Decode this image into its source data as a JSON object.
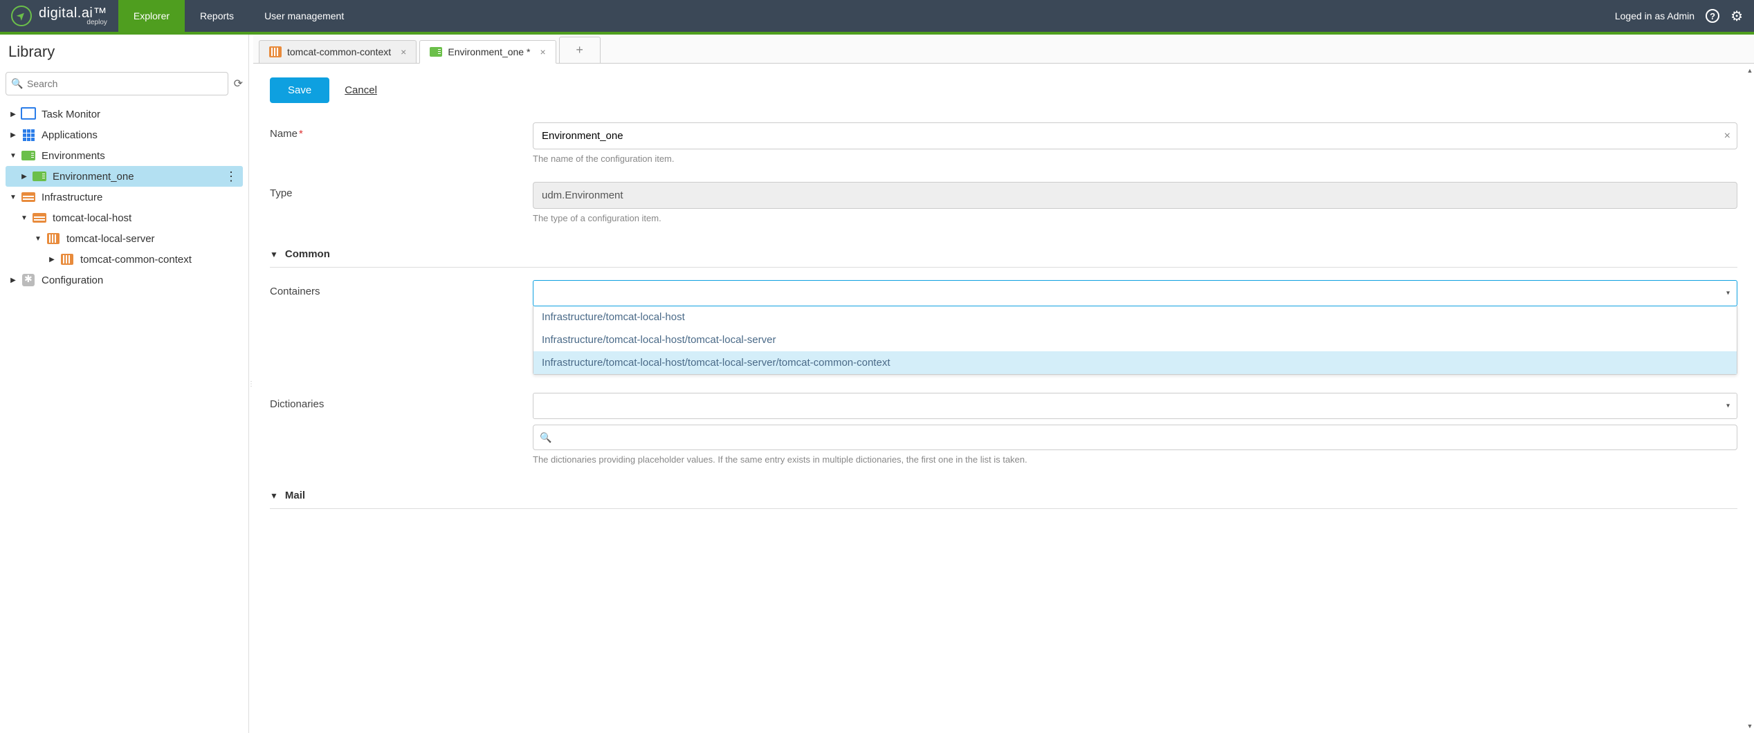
{
  "brand": {
    "name": "digital.ai",
    "sub": "deploy"
  },
  "nav": {
    "explorer": "Explorer",
    "reports": "Reports",
    "user_mgmt": "User management"
  },
  "topbar": {
    "logged_in": "Loged in as Admin"
  },
  "sidebar": {
    "title": "Library",
    "search_placeholder": "Search",
    "tree": {
      "task_monitor": "Task Monitor",
      "applications": "Applications",
      "environments": "Environments",
      "env_one": "Environment_one",
      "infrastructure": "Infrastructure",
      "tomcat_host": "tomcat-local-host",
      "tomcat_server": "tomcat-local-server",
      "tomcat_context": "tomcat-common-context",
      "configuration": "Configuration"
    }
  },
  "tabs": {
    "tab1": "tomcat-common-context",
    "tab2": "Environment_one *"
  },
  "form": {
    "save": "Save",
    "cancel": "Cancel",
    "name_label": "Name",
    "name_value": "Environment_one",
    "name_help": "The name of the configuration item.",
    "type_label": "Type",
    "type_value": "udm.Environment",
    "type_help": "The type of a configuration item.",
    "section_common": "Common",
    "containers_label": "Containers",
    "container_opts": {
      "o1": "Infrastructure/tomcat-local-host",
      "o2": "Infrastructure/tomcat-local-host/tomcat-local-server",
      "o3": "Infrastructure/tomcat-local-host/tomcat-local-server/tomcat-common-context"
    },
    "dictionaries_label": "Dictionaries",
    "dictionaries_help": "The dictionaries providing placeholder values. If the same entry exists in multiple dictionaries, the first one in the list is taken.",
    "section_mail": "Mail"
  }
}
